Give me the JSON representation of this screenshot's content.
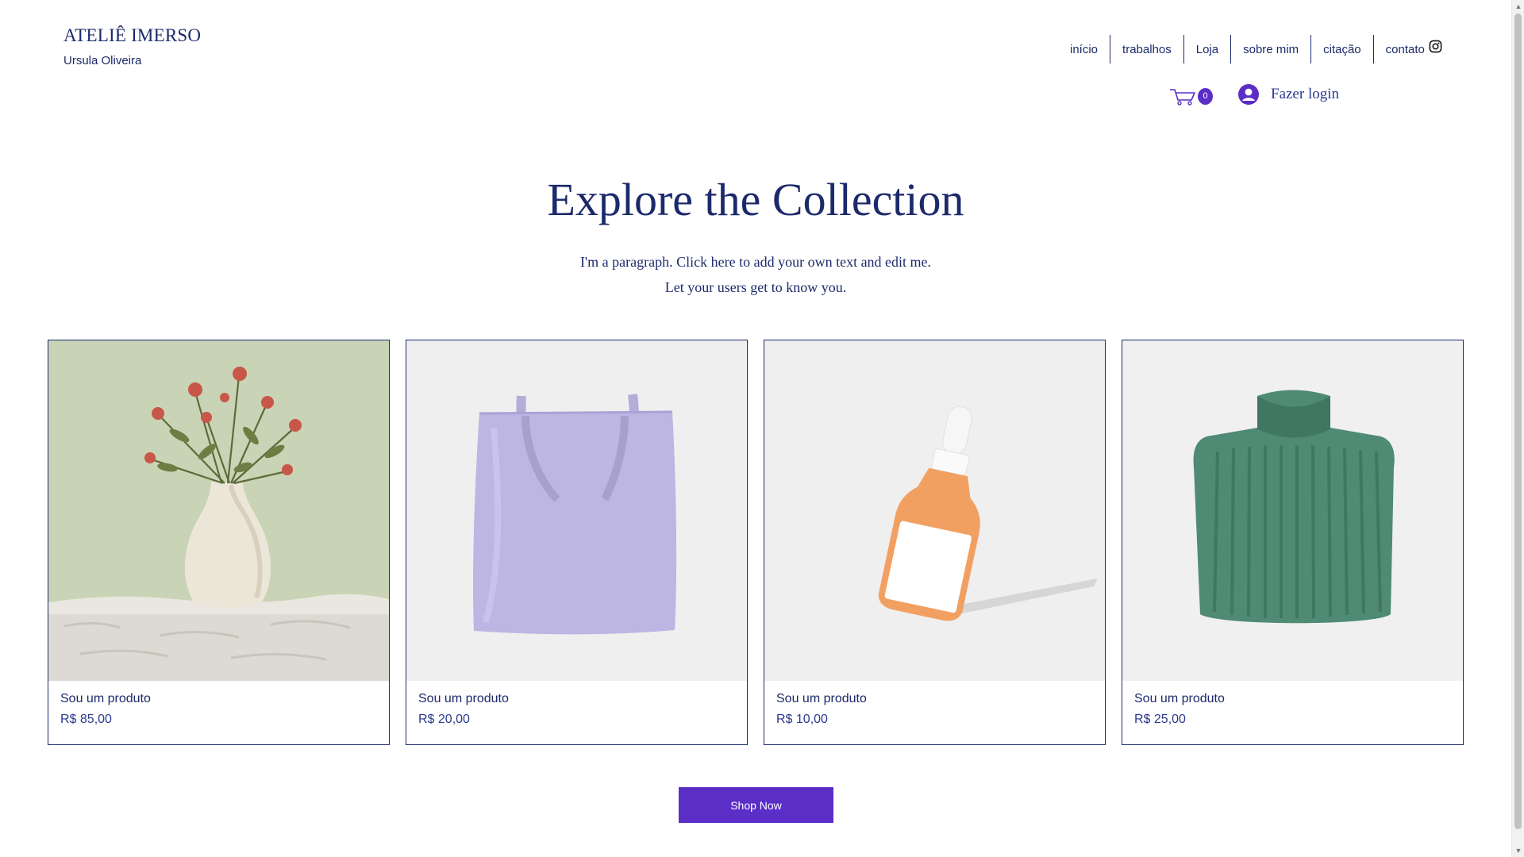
{
  "header": {
    "brand_title": "ATELIÊ IMERSO",
    "brand_subtitle": "Ursula Oliveira",
    "nav": [
      "início",
      "trabalhos",
      "Loja",
      "sobre mim",
      "citação",
      "contato"
    ],
    "cart_count": "0",
    "login_label": "Fazer login"
  },
  "hero": {
    "title": "Explore the Collection",
    "paragraph_line1": "I'm a paragraph. Click here to add your own text and edit me.",
    "paragraph_line2": "Let your users get to know you."
  },
  "products": [
    {
      "name": "Sou um produto",
      "price": "R$ 85,00",
      "image": "vase-with-flowers"
    },
    {
      "name": "Sou um produto",
      "price": "R$ 20,00",
      "image": "lavender-tote-bag"
    },
    {
      "name": "Sou um produto",
      "price": "R$ 10,00",
      "image": "orange-serum-bottle"
    },
    {
      "name": "Sou um produto",
      "price": "R$ 25,00",
      "image": "green-knit-sweater"
    }
  ],
  "cta": {
    "label": "Shop Now"
  },
  "colors": {
    "brand_navy": "#1c2a6b",
    "accent_purple": "#5b2ec8"
  }
}
